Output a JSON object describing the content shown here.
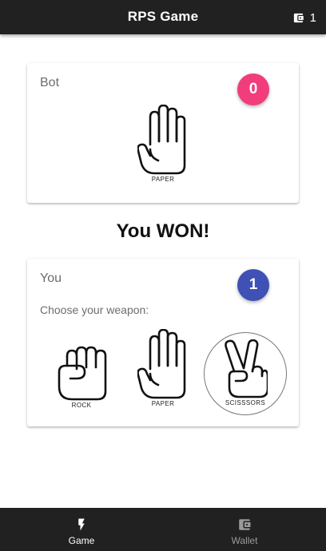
{
  "app": {
    "title": "RPS Game"
  },
  "topbar": {
    "wallet_icon": "wallet-icon",
    "wallet_count": "1"
  },
  "bot": {
    "name": "Bot",
    "score": "0",
    "score_color": "#f13d7c",
    "hand": {
      "icon": "paper-hand-icon",
      "label": "PAPER"
    }
  },
  "result": {
    "text": "You WON!"
  },
  "player": {
    "name": "You",
    "score": "1",
    "score_color": "#3f51b5",
    "prompt": "Choose your weapon:",
    "weapons": [
      {
        "icon": "rock-hand-icon",
        "label": "ROCK",
        "selected": false
      },
      {
        "icon": "paper-hand-icon",
        "label": "PAPER",
        "selected": false
      },
      {
        "icon": "scissors-hand-icon",
        "label": "SCISSSORS",
        "selected": true
      }
    ]
  },
  "bottom_nav": {
    "items": [
      {
        "icon": "lightning-icon",
        "label": "Game",
        "active": true
      },
      {
        "icon": "wallet-icon",
        "label": "Wallet",
        "active": false
      }
    ]
  }
}
